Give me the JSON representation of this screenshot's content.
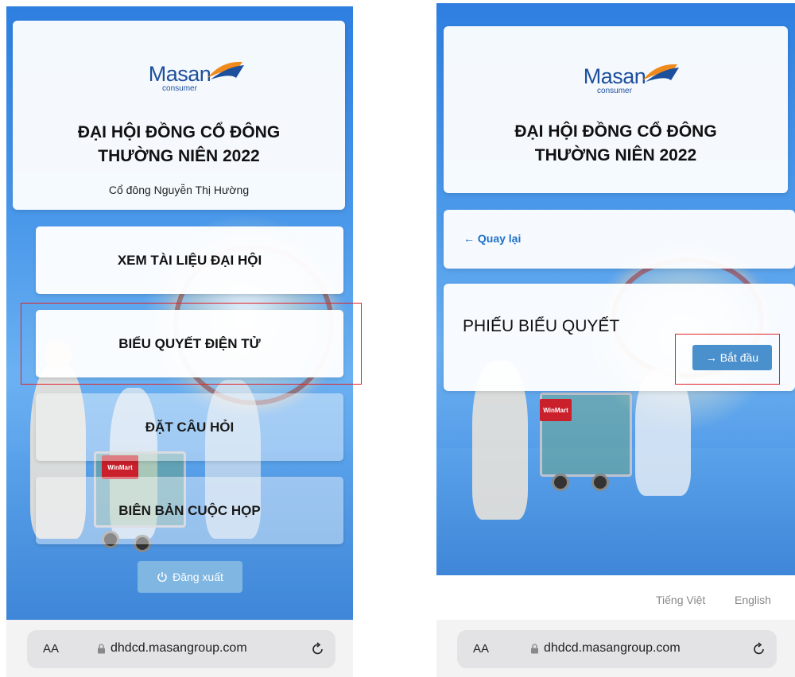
{
  "left_screen": {
    "logo": {
      "word": "Masan",
      "sub": "consumer"
    },
    "title_line1": "ĐẠI HỘI ĐỒNG CỔ ĐÔNG",
    "title_line2": "THƯỜNG NIÊN 2022",
    "shareholder": "Cổ đông Nguyễn Thị Hường",
    "menu": [
      {
        "label": "XEM TÀI LIỆU ĐẠI HỘI"
      },
      {
        "label": "BIỂU QUYẾT ĐIỆN TỬ"
      },
      {
        "label": "ĐẶT CÂU HỎI"
      },
      {
        "label": "BIÊN BẢN CUỘC HỌP"
      }
    ],
    "logout_label": "Đăng xuất",
    "logout_icon": "power-icon",
    "vinmart": "WinMart"
  },
  "right_screen": {
    "logo": {
      "word": "Masan",
      "sub": "consumer"
    },
    "title_line1": "ĐẠI HỘI ĐỒNG CỔ ĐÔNG",
    "title_line2": "THƯỜNG NIÊN 2022",
    "back_label": "← Quay lại",
    "ballot_title": "PHIẾU BIỂU QUYẾT",
    "start_label": "→ Bắt đầu",
    "languages": [
      "Tiếng Việt",
      "English"
    ],
    "vinmart": "WinMart"
  },
  "browser": {
    "aa_label": "AA",
    "url": "dhdcd.masangroup.com",
    "lock_icon": "lock-icon",
    "reload_icon": "reload-icon"
  },
  "colors": {
    "accent": "#4a90cc",
    "highlight": "#e0242b",
    "brand": "#1d4f9c"
  }
}
